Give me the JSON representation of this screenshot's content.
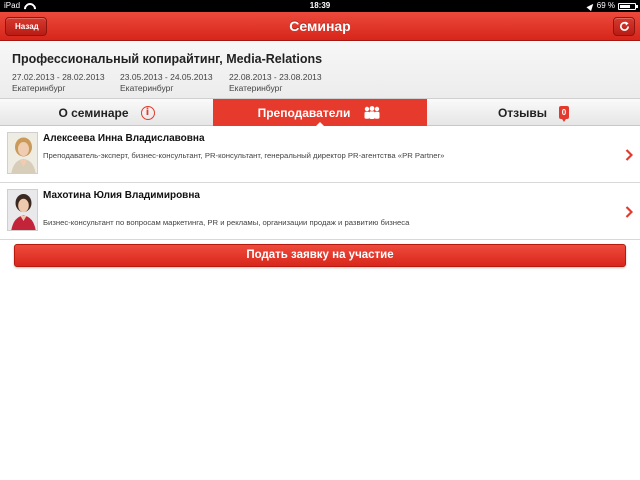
{
  "status_bar": {
    "carrier": "iPad",
    "time": "18:39",
    "battery": "69 %",
    "battery_level_pct": 69
  },
  "nav": {
    "back_label": "Назад",
    "title": "Семинар",
    "refresh_icon": "refresh-icon"
  },
  "seminar": {
    "title": "Профессиональный копирайтинг, Media-Relations",
    "sessions": [
      {
        "dates": "27.02.2013 - 28.02.2013",
        "city": "Екатеринбург"
      },
      {
        "dates": "23.05.2013 - 24.05.2013",
        "city": "Екатеринбург"
      },
      {
        "dates": "22.08.2013 - 23.08.2013",
        "city": "Екатеринбург"
      }
    ]
  },
  "tabs": [
    {
      "label": "О семинаре",
      "icon": "info-icon",
      "active": false
    },
    {
      "label": "Преподаватели",
      "icon": "people-icon",
      "active": true
    },
    {
      "label": "Отзывы",
      "icon": "comment-badge-icon",
      "badge": "0",
      "active": false
    }
  ],
  "lecturers": [
    {
      "name": "Алексеева Инна Владиславовна",
      "description": "Преподаватель-эксперт, бизнес-консультант, PR-консультант, генеральный директор PR-агентства «PR Partner»"
    },
    {
      "name": "Махотина Юлия Владимировна",
      "description": "Бизнес-консультант по вопросам маркетинга, PR и рекламы, организации продаж и развитию бизнеса"
    }
  ],
  "apply_button": "Подать заявку на участие",
  "colors": {
    "accent": "#e63a2c",
    "nav_bar": "#d7251b",
    "header_bg": "#f2f2f2"
  }
}
